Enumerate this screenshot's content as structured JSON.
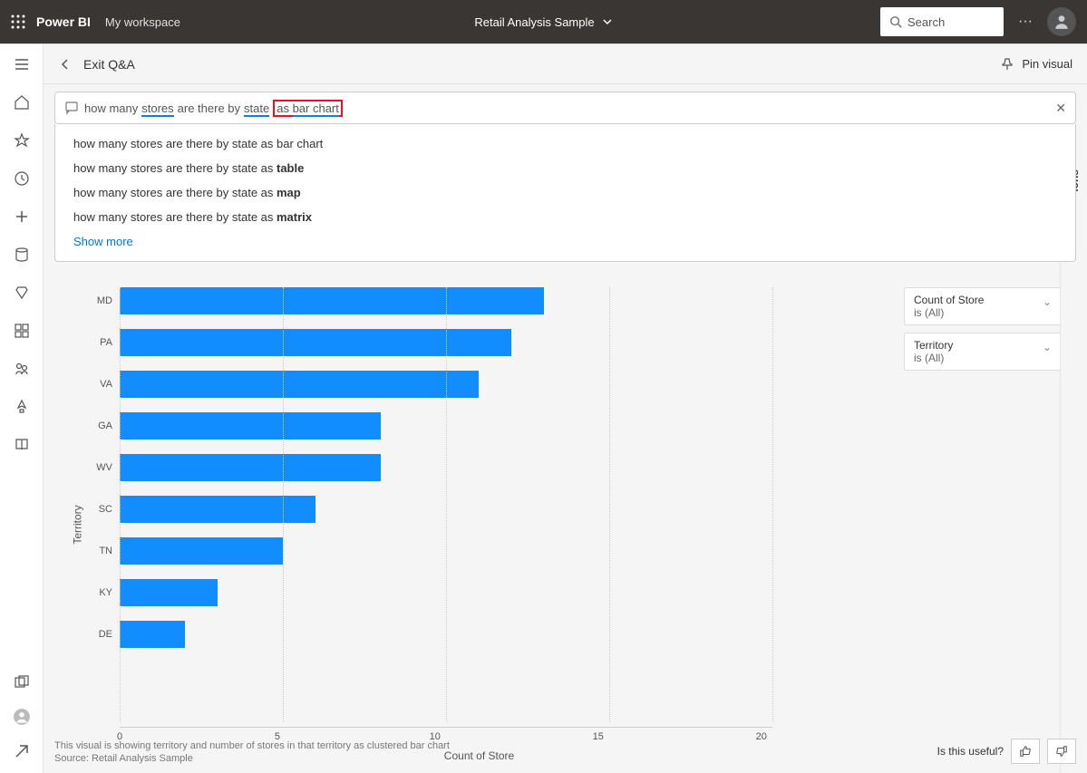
{
  "topbar": {
    "brand": "Power BI",
    "workspace": "My workspace",
    "title": "Retail Analysis Sample",
    "search_placeholder": "Search"
  },
  "cmdbar": {
    "back_label": "Exit Q&A",
    "pin_label": "Pin visual"
  },
  "qna": {
    "query_parts": [
      "how many ",
      "stores",
      " are there by ",
      "state",
      " as ",
      "bar chart"
    ],
    "suggestions": [
      {
        "prefix": "how many stores are there by state as bar chart",
        "suffix": ""
      },
      {
        "prefix": "how many stores are there by state as ",
        "suffix": "table"
      },
      {
        "prefix": "how many stores are there by state as ",
        "suffix": "map"
      },
      {
        "prefix": "how many stores are there by state as ",
        "suffix": "matrix"
      }
    ],
    "show_more": "Show more"
  },
  "chart_data": {
    "type": "bar",
    "orientation": "horizontal",
    "categories": [
      "MD",
      "PA",
      "VA",
      "GA",
      "WV",
      "SC",
      "TN",
      "KY",
      "DE"
    ],
    "values": [
      13,
      12,
      11,
      8,
      8,
      6,
      5,
      3,
      2
    ],
    "xlabel": "Count of Store",
    "ylabel": "Territory",
    "xlim": [
      0,
      20
    ],
    "xticks": [
      0,
      5,
      10,
      15,
      20
    ]
  },
  "filters": [
    {
      "name": "Count of Store",
      "value": "is (All)"
    },
    {
      "name": "Territory",
      "value": "is (All)"
    }
  ],
  "rightrail": {
    "label": "ions"
  },
  "footer": {
    "desc": "This visual is showing territory and number of stores in that territory as clustered bar chart",
    "source": "Source: Retail Analysis Sample",
    "useful": "Is this useful?"
  }
}
